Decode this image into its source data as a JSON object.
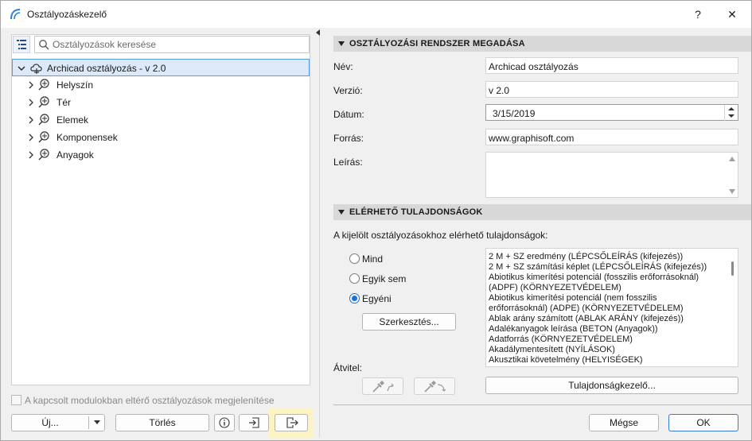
{
  "window": {
    "title": "Osztályozáskezelő",
    "help_label": "?",
    "close_label": "✕"
  },
  "left": {
    "search_placeholder": "Osztályozások keresése",
    "root": {
      "label": "Archicad osztályozás - v 2.0"
    },
    "children": [
      {
        "label": "Helyszín"
      },
      {
        "label": "Tér"
      },
      {
        "label": "Elemek"
      },
      {
        "label": "Komponensek"
      },
      {
        "label": "Anyagok"
      }
    ],
    "show_different_label": "A kapcsolt modulokban eltérő osztályozások megjelenítése",
    "new_label": "Új...",
    "delete_label": "Törlés"
  },
  "system": {
    "section_title": "OSZTÁLYOZÁSI RENDSZER MEGADÁSA",
    "name_label": "Név:",
    "name_value": "Archicad osztályozás",
    "version_label": "Verzió:",
    "version_value": "v 2.0",
    "date_label": "Dátum:",
    "date_value": "3/15/2019",
    "source_label": "Forrás:",
    "source_value": "www.graphisoft.com",
    "description_label": "Leírás:",
    "description_value": ""
  },
  "properties": {
    "section_title": "ELÉRHETŐ TULAJDONSÁGOK",
    "intro": "A kijelölt osztályozásokhoz elérhető tulajdonságok:",
    "options": [
      {
        "label": "Mind",
        "selected": false
      },
      {
        "label": "Egyik sem",
        "selected": false
      },
      {
        "label": "Egyéni",
        "selected": true
      }
    ],
    "edit_label": "Szerkesztés...",
    "transfer_label": "Átvitel:",
    "manager_label": "Tulajdonságkezelő...",
    "items": [
      "2 M + SZ eredmény (LÉPCSŐLEÍRÁS (kifejezés))",
      "2 M + SZ számítási képlet (LÉPCSŐLEÍRÁS (kifejezés))",
      "Abiotikus kimerítési potenciál (fosszilis erőforrásoknál)",
      "(ADPF) (KÖRNYEZETVÉDELEM)",
      "Abiotikus kimerítési potenciál (nem fosszilis",
      "erőforrásoknál) (ADPE) (KÖRNYEZETVÉDELEM)",
      "Ablak arány számított (ABLAK ARÁNY (kifejezés))",
      "Adalékanyagok leírása (BETON (Anyagok))",
      "Adatforrás (KÖRNYEZETVÉDELEM)",
      "Akadálymentesített (NYÍLÁSOK)",
      "Akusztikai követelmény (HELYISÉGEK)"
    ]
  },
  "footer": {
    "cancel_label": "Mégse",
    "ok_label": "OK"
  },
  "colors": {
    "accent": "#1f6fd1",
    "selection": "#dbe9f8",
    "highlight": "#fbf3c4"
  }
}
